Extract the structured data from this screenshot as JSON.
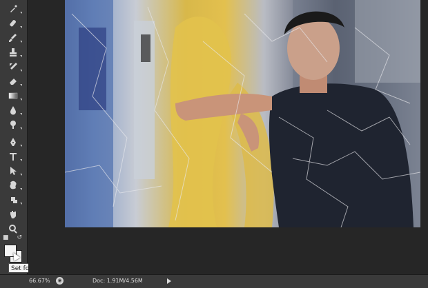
{
  "tooltip": {
    "text": "Set foreground color"
  },
  "status": {
    "zoom": "66.67%",
    "doc": "Doc: 1.91M/4.56M"
  },
  "swatches": {
    "foreground": "#f4f4f4",
    "background": "#f4f4f4"
  },
  "tools": [
    {
      "name": "eyedropper-icon"
    },
    {
      "name": "healing-brush-icon"
    },
    {
      "name": "brush-icon"
    },
    {
      "name": "clone-stamp-icon"
    },
    {
      "name": "history-brush-icon"
    },
    {
      "name": "eraser-icon"
    },
    {
      "name": "gradient-icon"
    },
    {
      "name": "blur-icon"
    },
    {
      "name": "dodge-icon"
    },
    {
      "name": "pen-icon"
    },
    {
      "name": "type-icon"
    },
    {
      "name": "path-selection-icon"
    },
    {
      "name": "shape-icon"
    },
    {
      "name": "3d-rotate-icon"
    },
    {
      "name": "hand-icon"
    },
    {
      "name": "zoom-icon"
    }
  ]
}
